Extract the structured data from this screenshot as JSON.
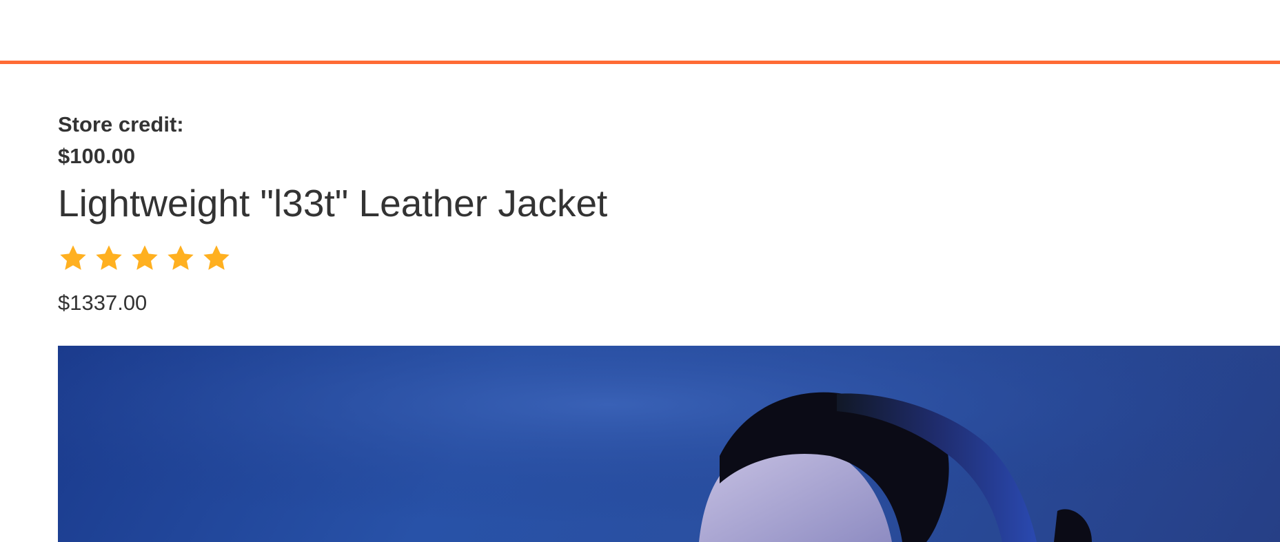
{
  "header": {
    "accent_color": "#ff6b35"
  },
  "account": {
    "store_credit_label": "Store credit:",
    "store_credit_value": "$100.00"
  },
  "product": {
    "title": "Lightweight \"l33t\" Leather Jacket",
    "rating": {
      "stars": 5,
      "max": 5,
      "star_color": "#ffb020",
      "icon": "star-icon"
    },
    "price": "$1337.00",
    "image": {
      "icon": "product-photo"
    }
  }
}
